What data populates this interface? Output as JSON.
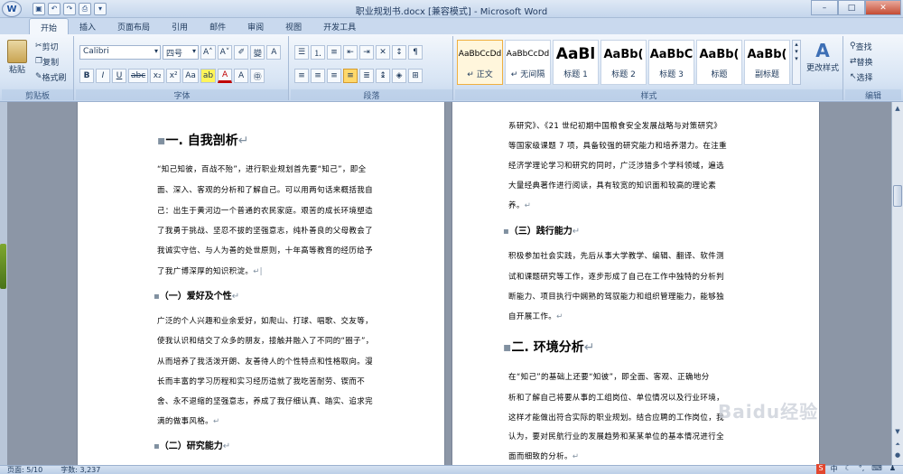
{
  "window": {
    "title": "职业规划书.docx [兼容模式] - Microsoft Word",
    "minimize": "–",
    "maximize": "□",
    "close": "✕"
  },
  "tabs": [
    "开始",
    "插入",
    "页面布局",
    "引用",
    "邮件",
    "审阅",
    "视图",
    "开发工具"
  ],
  "clipboard": {
    "paste": "粘贴",
    "cut": "剪切",
    "copy": "复制",
    "format_painter": "格式刷",
    "label": "剪贴板"
  },
  "font": {
    "name": "Calibri",
    "size": "四号",
    "label": "字体",
    "grow": "A˄",
    "shrink": "A˅",
    "bold": "B",
    "italic": "I",
    "underline": "U",
    "strike": "abc",
    "sub": "x₂",
    "sup": "x²",
    "case": "Aa",
    "highlight": "ab",
    "color": "A"
  },
  "paragraph": {
    "label": "段落"
  },
  "styles": {
    "label": "样式",
    "items": [
      {
        "sample": "AaBbCcDd",
        "name": "↵ 正文"
      },
      {
        "sample": "AaBbCcDd",
        "name": "↵ 无间隔"
      },
      {
        "sample": "AaBl",
        "name": "标题 1"
      },
      {
        "sample": "AaBb(",
        "name": "标题 2"
      },
      {
        "sample": "AaBbC",
        "name": "标题 3"
      },
      {
        "sample": "AaBb(",
        "name": "标题"
      },
      {
        "sample": "AaBb(",
        "name": "副标题"
      }
    ],
    "change": "更改样式"
  },
  "editing": {
    "label": "编辑",
    "find": "查找",
    "replace": "替换",
    "select": "选择"
  },
  "left_page": {
    "h1": "一. 自我剖析",
    "p1": [
      "“知己知彼，百战不殆”，进行职业规划首先要“知己”，即全",
      "面、深入、客观的分析和了解自己。可以用两句话来概括我自",
      "己：出生于黄河边一个普通的农民家庭。艰苦的成长环境塑造",
      "了我勇于挑战、坚忍不拔的坚强意志，纯朴善良的父母教会了",
      "我诚实守信、与人为善的处世原则，十年高等教育的经历给予",
      "了我广博深厚的知识积淀。"
    ],
    "h2a": "（一）爱好及个性",
    "p2": [
      "广泛的个人兴趣和业余爱好，如爬山、打球、唱歌、交友等，",
      "使我认识和结交了众多的朋友，接触并融入了不同的“圈子”，",
      "从而培养了我活泼开朗、友善待人的个性特点和性格取向。漫",
      "长而丰富的学习历程和实习经历造就了我吃苦耐劳、锲而不",
      "舍、永不退缩的坚强意志，养成了我仔细认真、踏实、追求完",
      "满的做事风格。"
    ],
    "h2b": "（二）研究能力"
  },
  "right_page": {
    "p0": [
      "系研究》、《21 世纪初期中国粮食安全发展战略与对策研究》",
      "等国家级课题 7 项，具备较强的研究能力和培养潜力。在注重",
      "经济学理论学习和研究的同时，广泛涉猎多个学科领域，遍选",
      "大量经典著作进行阅读，具有较宽的知识面和较高的理论素",
      "养。"
    ],
    "h2c": "（三）践行能力",
    "p1": [
      "积极参加社会实践，先后从事大学教学、编辑、翻译、软件测",
      "试和课题研究等工作，逐步形成了自己在工作中独特的分析判",
      "断能力、项目执行中娴熟的驾驭能力和组织管理能力，能够独",
      "自开展工作。"
    ],
    "h1": "二. 环境分析",
    "p2": [
      "在“知己”的基础上还要“知彼”，即全面、客观、正确地分",
      "析和了解自己将要从事的工组岗位、单位情况以及行业环境，",
      "这样才能做出符合实际的职业规划。结合应聘的工作岗位，我",
      "认为，要对民航行业的发展趋势和某某单位的基本情况进行全",
      "面而细致的分析。"
    ]
  },
  "status": {
    "page": "页面: 5/10",
    "words": "字数: 3,237"
  },
  "watermark": "Baidu经验"
}
